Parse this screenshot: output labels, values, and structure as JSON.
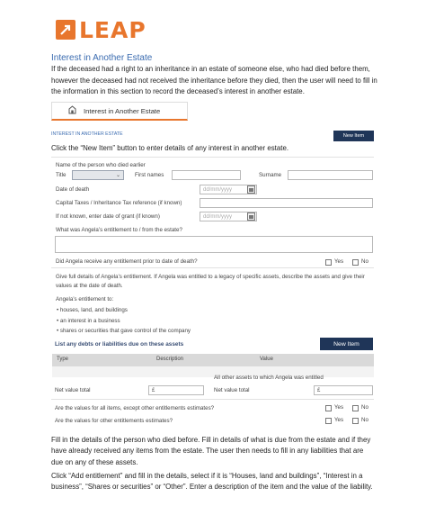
{
  "logo": {
    "text": "LEAP"
  },
  "section_heading": "Interest in Another Estate",
  "intro": "If the deceased had a right to an inheritance in an estate of someone else, who had died before them, however the deceased had not received the inheritance before they died, then the user will need to fill in the information in this section to record the deceased’s interest in another estate.",
  "tab": {
    "label": "Interest in Another Estate",
    "icon": "estate-icon"
  },
  "form": {
    "title": "INTEREST IN ANOTHER ESTATE",
    "new_item_label": "New Item",
    "instruction": "Click the “New Item” button to enter details of any interest in another estate.",
    "name_label": "Name of the person who died earlier",
    "title_label": "Title",
    "first_names_label": "First names",
    "surname_label": "Surname",
    "date_of_death_label": "Date of death",
    "date_placeholder": "dd/mm/yyyy",
    "cti_label": "Capital Taxes / Inheritance Tax reference (if known)",
    "grant_label": "If not known, enter date of grant (if known)",
    "entitlement_q": "What was Angela’s entitlement to / from the estate?",
    "received_q": "Did Angela receive any entitlement prior to date of death?",
    "yes": "Yes",
    "no": "No",
    "full_details": "Give full details of Angela’s entitlement. If Angela was entitled to a legacy of specific assets, describe the assets and give their values at the date of death.",
    "entitlement_to": "Angela’s entitlement to:",
    "bullets": [
      "• houses, land, and buildings",
      "• an interest in a business",
      "• shares or securities that gave control of the company"
    ],
    "liabilities_heading": "List any debts or liabilities due on these assets",
    "liabilities_new_item": "New Item",
    "table_headers": [
      "Type",
      "Description",
      "Value"
    ],
    "other_assets_label": "All other assets to which Angela was entitled",
    "net_value_label": "Net value total",
    "currency": "£",
    "values_all_q": "Are the values for all items, except other entitlements estimates?",
    "values_other_q": "Are the values for other entitlements estimates?"
  },
  "bottom_text_1": "Fill in the details of the person who died before. Fill in details of what is due from the estate and if they have already received any items from the estate. The user then needs to fill in any liabilities that are due on any of these assets.",
  "bottom_text_2": "Click “Add entitlement” and fill in the details, select if it is “Houses, land and buildings”, “Interest in a business”, “Shares or securities” or “Other”. Enter a description of the item and the value of the liability.",
  "colors": {
    "brand": "#e8762d",
    "heading_blue": "#3a6bb0",
    "button_navy": "#1f3558"
  }
}
